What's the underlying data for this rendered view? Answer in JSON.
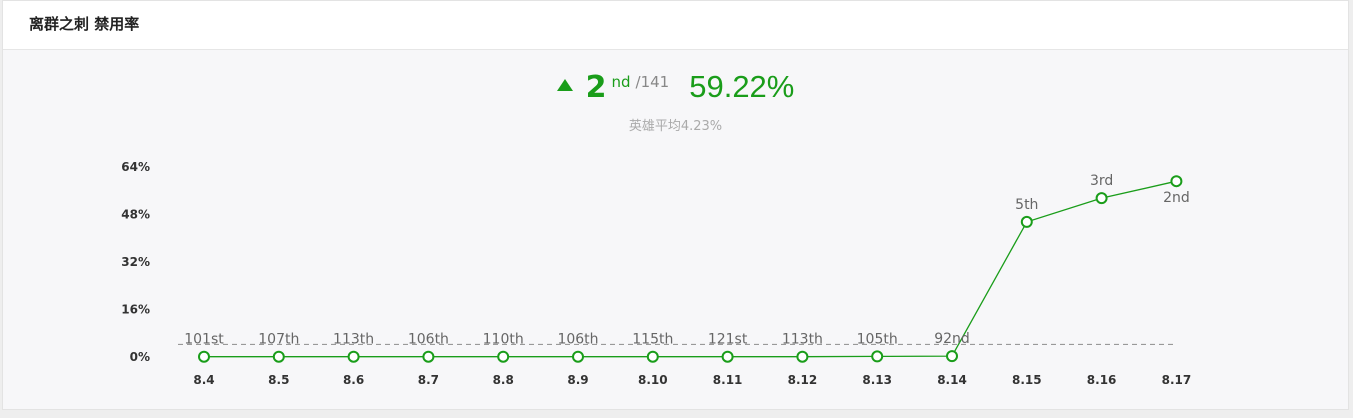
{
  "header": {
    "title": "离群之刺 禁用率"
  },
  "summary": {
    "rank": "2",
    "rank_suffix": "nd",
    "rank_total": "/141",
    "rate": "59.22%",
    "avg": "英雄平均4.23%",
    "up_icon": "triangle-up-icon",
    "accent_color": "#1a9d1a"
  },
  "chart_data": {
    "type": "line",
    "categories": [
      "8.4",
      "8.5",
      "8.6",
      "8.7",
      "8.8",
      "8.9",
      "8.10",
      "8.11",
      "8.12",
      "8.13",
      "8.14",
      "8.15",
      "8.16",
      "8.17"
    ],
    "values": [
      0.1,
      0.1,
      0.1,
      0.1,
      0.1,
      0.1,
      0.1,
      0.1,
      0.1,
      0.2,
      0.3,
      45.5,
      53.5,
      59.22
    ],
    "rank_labels": [
      "101st",
      "107th",
      "113th",
      "106th",
      "110th",
      "106th",
      "115th",
      "121st",
      "113th",
      "105th",
      "92nd",
      "5th",
      "3rd",
      "2nd"
    ],
    "yticks": [
      "0%",
      "16%",
      "32%",
      "48%",
      "64%"
    ],
    "ylim": [
      0,
      64
    ],
    "reference_line": 4.23,
    "line_color": "#1a9d1a",
    "reference_color": "#999999"
  }
}
